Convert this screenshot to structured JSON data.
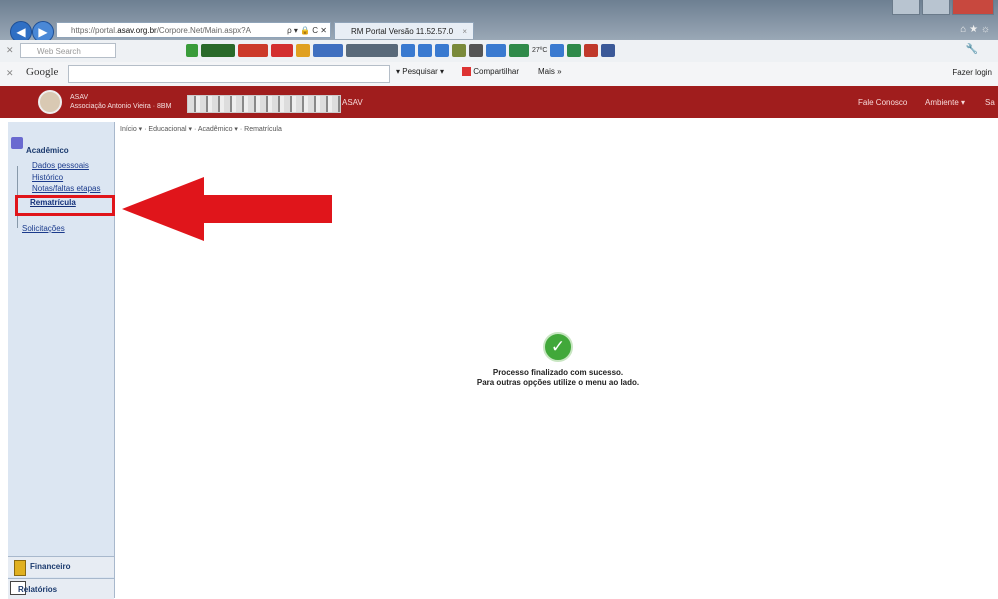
{
  "browser": {
    "url_prefix": "https://portal.",
    "url_host": "asav.org.br",
    "url_path": "/Corpore.Net/Main.aspx?A",
    "address_controls": "ρ ▾ 🔒 C ✕",
    "tab_title": "RM Portal Versão 11.52.57.0",
    "tab_close": "×",
    "window_icons": "⌂ ★ ☼"
  },
  "toolbar": {
    "web_search_placeholder": "Web Search",
    "temperature": "27ºC"
  },
  "google_bar": {
    "logo": "Google",
    "pesquisar_label": "Pesquisar",
    "compartilhar_label": "Compartilhar",
    "mais_label": "Mais »",
    "fazer_login_label": "Fazer login"
  },
  "portal_header": {
    "org_short": "ASAV",
    "org_name": "Associação Antonio Vieira · 8BM",
    "org_suffix": "ASAV",
    "fale_conosco": "Fale Conosco",
    "ambiente": "Ambiente ▾",
    "sair": "Sa"
  },
  "breadcrumb": "Início ▾ · Educacional ▾ · Acadêmico ▾ · Rematrícula",
  "sidebar": {
    "section_title": "Acadêmico",
    "items": [
      {
        "label": "Dados pessoais"
      },
      {
        "label": "Histórico"
      },
      {
        "label": "Notas/faltas etapas"
      },
      {
        "label": "Rematrícula"
      },
      {
        "label": "Solicitações"
      }
    ],
    "bottom_sections": [
      {
        "label": "Financeiro"
      },
      {
        "label": "Relatórios"
      }
    ]
  },
  "main": {
    "success_line1": "Processo finalizado com sucesso.",
    "success_line2": "Para outras opções utilize o menu ao lado."
  },
  "colors": {
    "header_red": "#a01d1d",
    "annotation_red": "#e0151b",
    "success_green": "#41a83a"
  }
}
